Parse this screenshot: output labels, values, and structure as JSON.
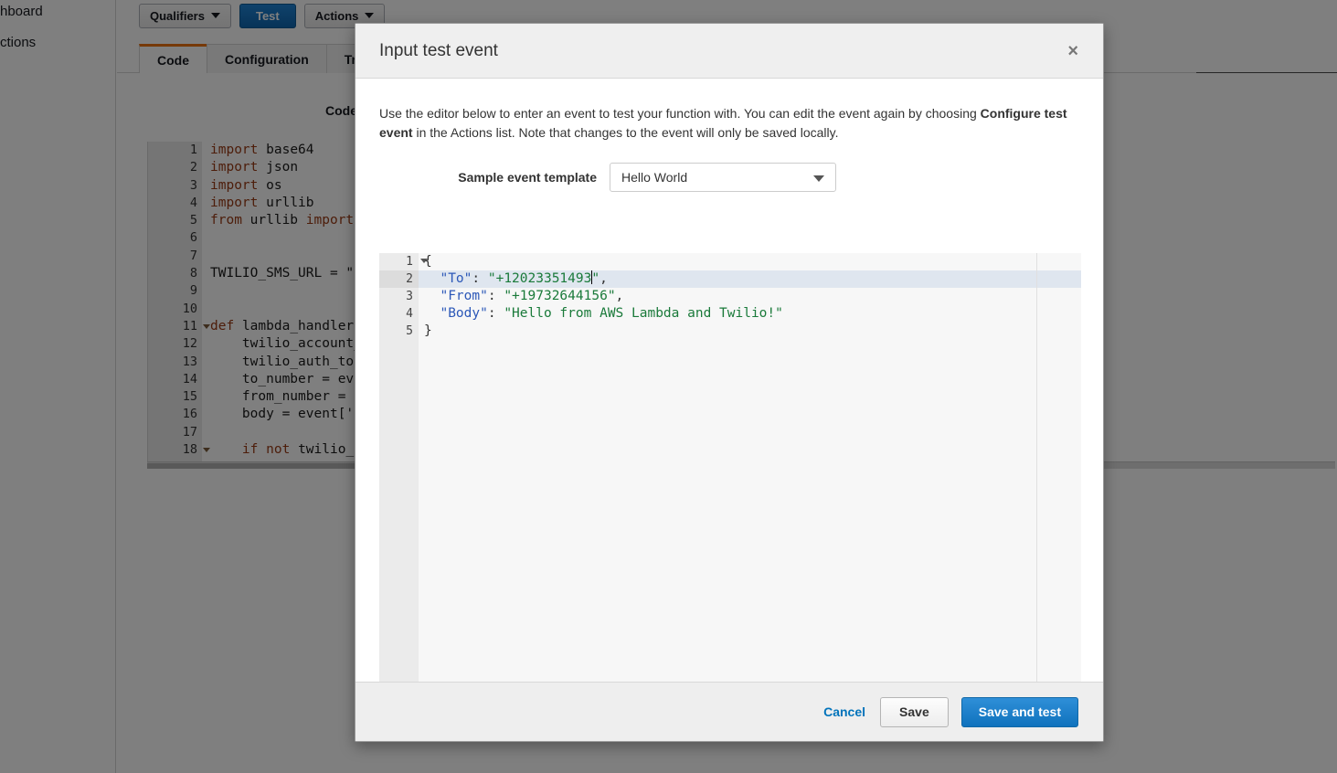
{
  "background": {
    "sidebar": {
      "items": [
        {
          "label": "hboard"
        },
        {
          "label": "ctions"
        }
      ]
    },
    "toolbar": {
      "qualifiers_label": "Qualifiers",
      "test_label": "Test",
      "actions_label": "Actions"
    },
    "tabs": [
      {
        "label": "Code",
        "active": true
      },
      {
        "label": "Configuration",
        "active": false
      },
      {
        "label": "Trig",
        "active": false
      }
    ],
    "code_panel": {
      "heading": "Code",
      "lines": [
        {
          "num": "1",
          "fold": false,
          "text": "import base64"
        },
        {
          "num": "2",
          "fold": false,
          "text": "import json"
        },
        {
          "num": "3",
          "fold": false,
          "text": "import os"
        },
        {
          "num": "4",
          "fold": false,
          "text": "import urllib"
        },
        {
          "num": "5",
          "fold": false,
          "text": "from urllib import "
        },
        {
          "num": "6",
          "fold": false,
          "text": ""
        },
        {
          "num": "7",
          "fold": false,
          "text": ""
        },
        {
          "num": "8",
          "fold": false,
          "text": "TWILIO_SMS_URL = \"h"
        },
        {
          "num": "9",
          "fold": false,
          "text": ""
        },
        {
          "num": "10",
          "fold": false,
          "text": ""
        },
        {
          "num": "11",
          "fold": true,
          "text": "def lambda_handler("
        },
        {
          "num": "12",
          "fold": false,
          "text": "    twilio_account_"
        },
        {
          "num": "13",
          "fold": false,
          "text": "    twilio_auth_tok"
        },
        {
          "num": "14",
          "fold": false,
          "text": "    to_number = eve"
        },
        {
          "num": "15",
          "fold": false,
          "text": "    from_number = e"
        },
        {
          "num": "16",
          "fold": false,
          "text": "    body = event['B"
        },
        {
          "num": "17",
          "fold": false,
          "text": ""
        },
        {
          "num": "18",
          "fold": true,
          "text": "    if not twilio_a"
        }
      ]
    }
  },
  "modal": {
    "title": "Input test event",
    "close_label": "×",
    "description_part1": "Use the editor below to enter an event to test your function with. You can edit the event again by choosing ",
    "description_bold1": "Configure test event",
    "description_part2": " in the Actions list. Note that changes to the event will only be saved locally.",
    "template_label": "Sample event template",
    "template_selected": "Hello World",
    "template_options": [
      "Hello World"
    ],
    "editor": {
      "lines": [
        {
          "num": "1",
          "fold": true,
          "active": false,
          "tokens": [
            {
              "t": "{",
              "c": "j-punc"
            }
          ]
        },
        {
          "num": "2",
          "fold": false,
          "active": true,
          "tokens": [
            {
              "t": "  ",
              "c": "j-punc"
            },
            {
              "t": "\"To\"",
              "c": "j-key"
            },
            {
              "t": ": ",
              "c": "j-punc"
            },
            {
              "t": "\"+12023351493",
              "c": "j-str"
            },
            {
              "t": "CURSOR",
              "c": "cursor"
            },
            {
              "t": "\"",
              "c": "j-str"
            },
            {
              "t": ",",
              "c": "j-punc"
            }
          ]
        },
        {
          "num": "3",
          "fold": false,
          "active": false,
          "tokens": [
            {
              "t": "  ",
              "c": "j-punc"
            },
            {
              "t": "\"From\"",
              "c": "j-key"
            },
            {
              "t": ": ",
              "c": "j-punc"
            },
            {
              "t": "\"+19732644156\"",
              "c": "j-str"
            },
            {
              "t": ",",
              "c": "j-punc"
            }
          ]
        },
        {
          "num": "4",
          "fold": false,
          "active": false,
          "tokens": [
            {
              "t": "  ",
              "c": "j-punc"
            },
            {
              "t": "\"Body\"",
              "c": "j-key"
            },
            {
              "t": ": ",
              "c": "j-punc"
            },
            {
              "t": "\"Hello from AWS Lambda and Twilio!\"",
              "c": "j-str"
            }
          ]
        },
        {
          "num": "5",
          "fold": false,
          "active": false,
          "tokens": [
            {
              "t": "}",
              "c": "j-punc"
            }
          ]
        }
      ],
      "json_value": "{\n  \"To\": \"+12023351493\",\n  \"From\": \"+19732644156\",\n  \"Body\": \"Hello from AWS Lambda and Twilio!\"\n}"
    },
    "footer": {
      "cancel_label": "Cancel",
      "save_label": "Save",
      "save_and_test_label": "Save and test"
    }
  },
  "colors": {
    "accent_blue": "#0073bb",
    "primary_button": "#1072bd",
    "active_tab_border": "#ec7211",
    "json_key": "#2c58b8",
    "json_string": "#1a7a3a",
    "active_line": "#dfe6ef"
  }
}
